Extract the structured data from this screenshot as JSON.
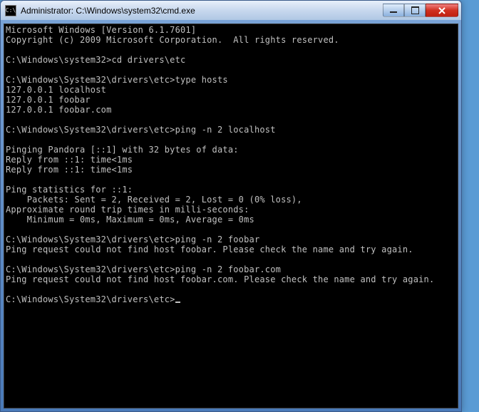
{
  "titlebar": {
    "icon_label": "C:\\",
    "title": "Administrator: C:\\Windows\\system32\\cmd.exe"
  },
  "window_controls": {
    "minimize": "Minimize",
    "maximize": "Maximize",
    "close": "Close"
  },
  "console": {
    "lines": [
      "Microsoft Windows [Version 6.1.7601]",
      "Copyright (c) 2009 Microsoft Corporation.  All rights reserved.",
      "",
      "C:\\Windows\\system32>cd drivers\\etc",
      "",
      "C:\\Windows\\System32\\drivers\\etc>type hosts",
      "127.0.0.1 localhost",
      "127.0.0.1 foobar",
      "127.0.0.1 foobar.com",
      "",
      "C:\\Windows\\System32\\drivers\\etc>ping -n 2 localhost",
      "",
      "Pinging Pandora [::1] with 32 bytes of data:",
      "Reply from ::1: time<1ms",
      "Reply from ::1: time<1ms",
      "",
      "Ping statistics for ::1:",
      "    Packets: Sent = 2, Received = 2, Lost = 0 (0% loss),",
      "Approximate round trip times in milli-seconds:",
      "    Minimum = 0ms, Maximum = 0ms, Average = 0ms",
      "",
      "C:\\Windows\\System32\\drivers\\etc>ping -n 2 foobar",
      "Ping request could not find host foobar. Please check the name and try again.",
      "",
      "C:\\Windows\\System32\\drivers\\etc>ping -n 2 foobar.com",
      "Ping request could not find host foobar.com. Please check the name and try again.",
      "",
      "C:\\Windows\\System32\\drivers\\etc>"
    ]
  }
}
